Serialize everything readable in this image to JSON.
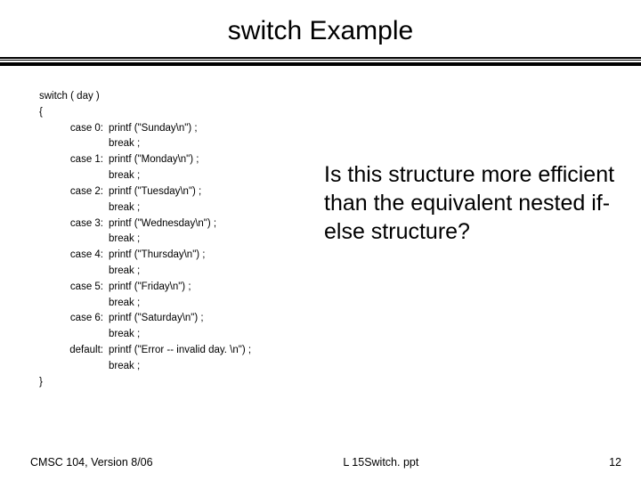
{
  "title": "switch Example",
  "code": {
    "open_line": "switch ( day )",
    "brace_open": "{",
    "brace_close": "}",
    "indent_break": "break ;",
    "cases": [
      {
        "label": "case 0:",
        "stmt": "printf (\"Sunday\\n\") ;"
      },
      {
        "label": "case 1:",
        "stmt": "printf (\"Monday\\n\") ;"
      },
      {
        "label": "case 2:",
        "stmt": "printf (\"Tuesday\\n\") ;"
      },
      {
        "label": "case 3:",
        "stmt": "printf (\"Wednesday\\n\") ;"
      },
      {
        "label": "case 4:",
        "stmt": "printf (\"Thursday\\n\") ;"
      },
      {
        "label": "case 5:",
        "stmt": "printf (\"Friday\\n\") ;"
      },
      {
        "label": "case 6:",
        "stmt": "printf (\"Saturday\\n\") ;"
      }
    ],
    "default": {
      "label": "default:",
      "stmt": "printf (\"Error -- invalid day. \\n\") ;"
    }
  },
  "question": "Is this structure more efficient than the equivalent nested if-else structure?",
  "footer": {
    "left": "CMSC 104, Version 8/06",
    "center": "L 15Switch. ppt",
    "right": "12"
  }
}
